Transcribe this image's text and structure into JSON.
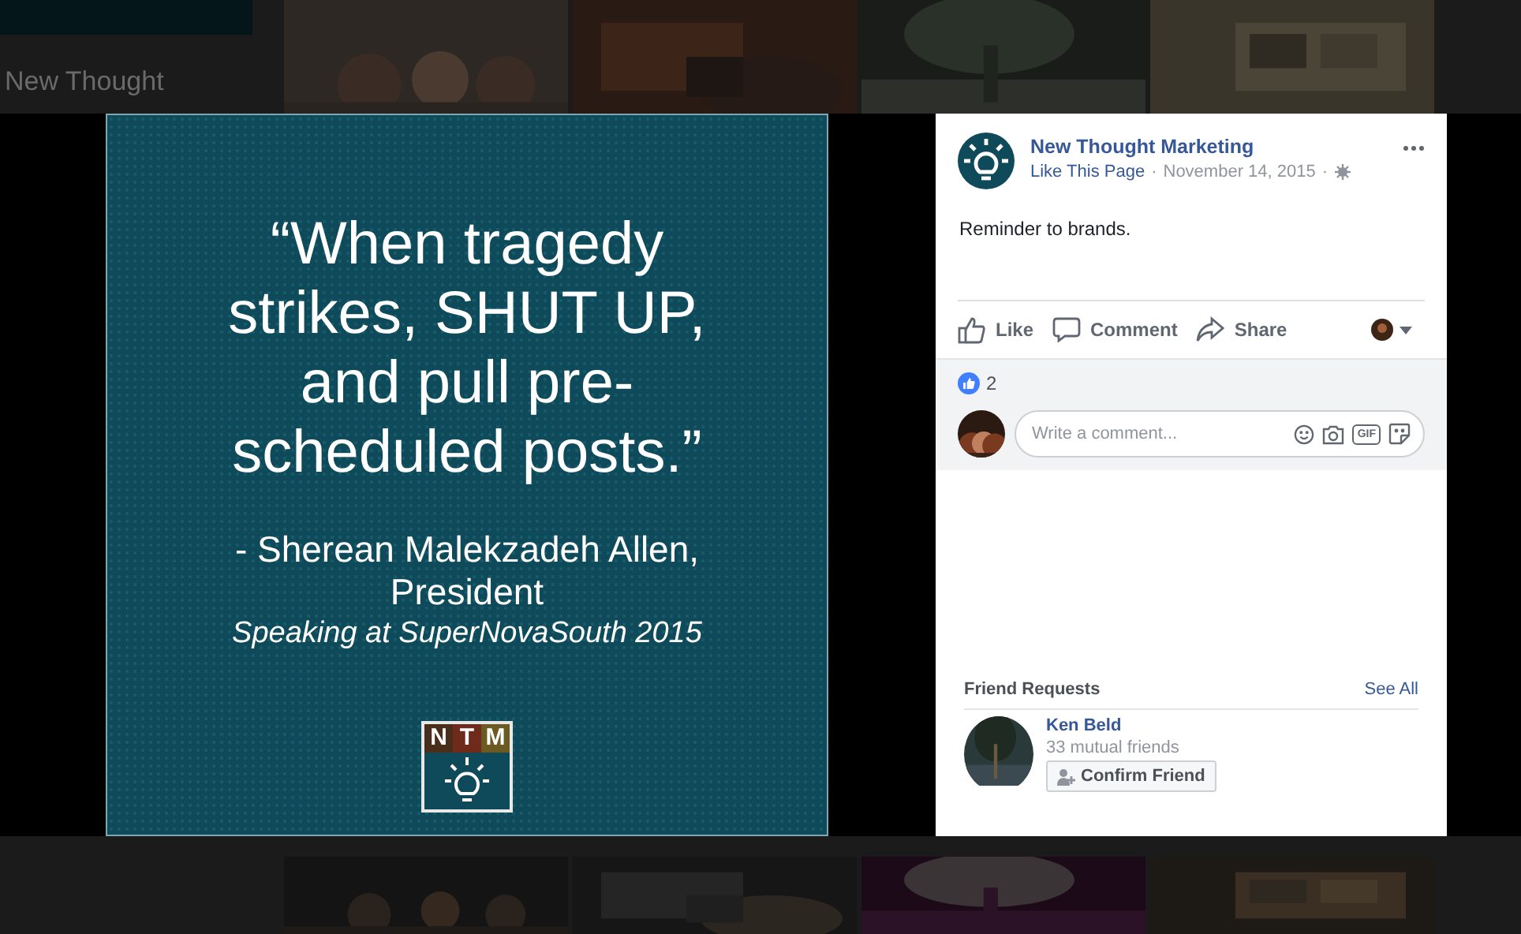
{
  "background": {
    "page_title": "New Thought"
  },
  "photo": {
    "quote_lines": [
      "“When tragedy",
      "strikes, SHUT UP,",
      "and pull pre-",
      "scheduled posts.”"
    ],
    "attribution_lines": [
      "- Sherean Malekzadeh Allen,",
      "President"
    ],
    "event": "Speaking at SuperNovaSouth 2015",
    "logo_letters": [
      {
        "letter": "N",
        "color": "#4a2e1c"
      },
      {
        "letter": "T",
        "color": "#6e2a1a"
      },
      {
        "letter": "M",
        "color": "#6b5a22"
      }
    ]
  },
  "post": {
    "page_name": "New Thought Marketing",
    "like_page": "Like This Page",
    "date": "November 14, 2015",
    "separator": "·",
    "text": "Reminder to brands.",
    "actions": [
      {
        "kind": "like",
        "label": "Like"
      },
      {
        "kind": "comment",
        "label": "Comment"
      },
      {
        "kind": "share",
        "label": "Share"
      }
    ],
    "reaction_count": "2",
    "comment_placeholder": "Write a comment...",
    "gif_label": "GIF"
  },
  "friend_requests": {
    "title": "Friend Requests",
    "see_all": "See All",
    "items": [
      {
        "name": "Ken Beld",
        "mutual": "33 mutual friends",
        "button": "Confirm Friend"
      }
    ]
  }
}
